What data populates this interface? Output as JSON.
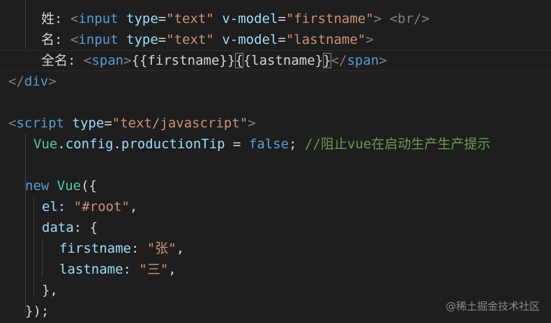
{
  "editor": {
    "theme": {
      "background": "#1e1e1e",
      "tag": "#569cd6",
      "attribute": "#9cdcfe",
      "string": "#ce9178",
      "comment": "#6a9955",
      "class": "#4ec9b0",
      "function": "#dcdcaa",
      "punctuation": "#808080",
      "text": "#d4d4d4"
    },
    "lines": {
      "l1": {
        "label": "姓: ",
        "open": "<",
        "tag": "input",
        "attr1": "type",
        "eq1": "=",
        "val1": "\"text\"",
        "attr2": "v-model",
        "eq2": "=",
        "val2": "\"firstname\"",
        "close": ">",
        "br": "<br/>"
      },
      "l2": {
        "label": "名: ",
        "open": "<",
        "tag": "input",
        "attr1": "type",
        "eq1": "=",
        "val1": "\"text\"",
        "attr2": "v-model",
        "eq2": "=",
        "val2": "\"lastname\"",
        "close": ">"
      },
      "l3": {
        "label": "全名: ",
        "open": "<",
        "tag": "span",
        "close": ">",
        "mus1": "{{firstname}}",
        "mus2_open": "{",
        "mus2_mid": "{lastname}",
        "mus2_close": "}",
        "end_open": "</",
        "end_tag": "span",
        "end_close": ">"
      },
      "l4": {
        "open": "</",
        "tag": "div",
        "close": ">"
      },
      "l6": {
        "open": "<",
        "tag": "script",
        "attr": "type",
        "eq": "=",
        "val": "\"text/javascript\"",
        "close": ">"
      },
      "l7": {
        "obj": "Vue",
        "dot1": ".",
        "prop1": "config",
        "dot2": ".",
        "prop2": "productionTip",
        "op": " = ",
        "bool": "false",
        "semi": ";",
        "comment": "//阻止vue在启动生产生产提示"
      },
      "l9": {
        "kw": "new",
        "cls": "Vue",
        "punct": "({"
      },
      "l10": {
        "key": "el",
        "colon": ": ",
        "val": "\"#root\"",
        "comma": ","
      },
      "l11": {
        "key": "data",
        "colon": ": ",
        "brace": "{"
      },
      "l12": {
        "key": "firstname",
        "colon": ": ",
        "val": "\"张\"",
        "comma": ","
      },
      "l13": {
        "key": "lastname",
        "colon": ": ",
        "val": "\"三\"",
        "comma": ","
      },
      "l14": {
        "text": "},"
      },
      "l15": {
        "text": "});"
      }
    }
  },
  "watermark": "@稀土掘金技术社区"
}
